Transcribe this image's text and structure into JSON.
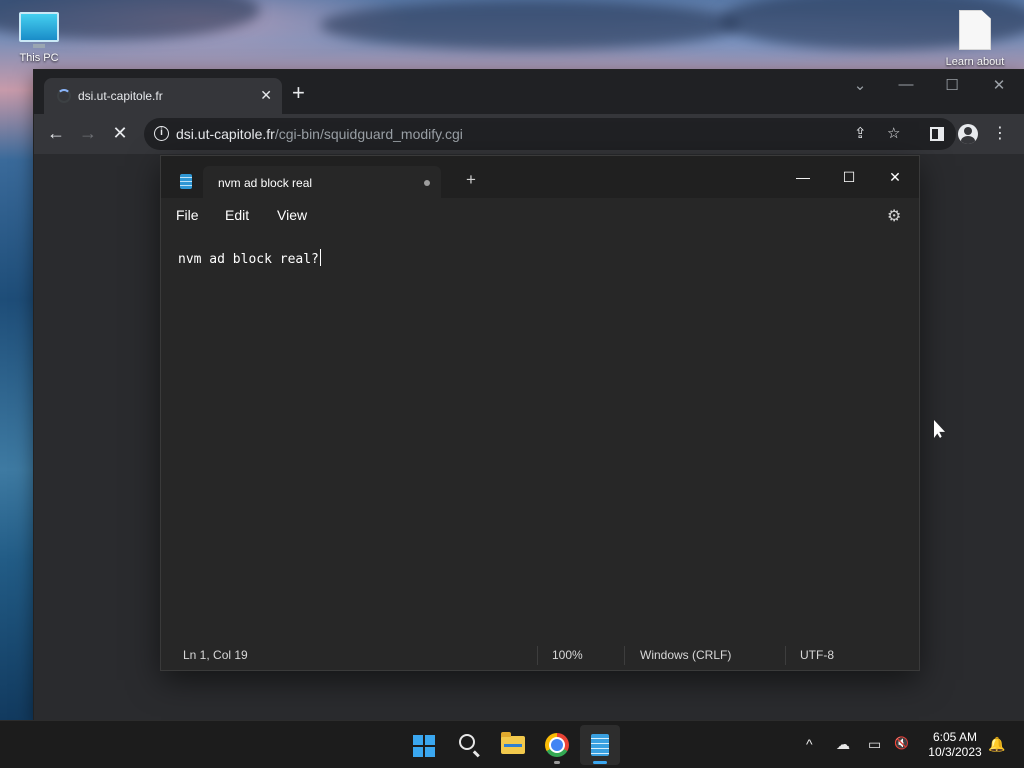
{
  "desktop": {
    "icons": [
      {
        "label": "This PC",
        "icon": "computer-monitor-icon"
      },
      {
        "label": "Learn about",
        "icon": "document-file-icon"
      }
    ]
  },
  "browser": {
    "tab": {
      "title": "dsi.ut-capitole.fr",
      "loading": true
    },
    "new_tab_symbol": "+",
    "url_host": "dsi.ut-capitole.fr",
    "url_path": "/cgi-bin/squidguard_modify.cgi",
    "icons": {
      "back": "←",
      "forward": "→",
      "stop": "✕",
      "share": "⇪",
      "bookmark": "☆",
      "menu": "⋮",
      "tab_close": "✕",
      "tab_search": "⌄",
      "minimize": "—",
      "maximize": "☐",
      "close": "✕"
    }
  },
  "notepad": {
    "tab_title": "nvm ad block real",
    "new_tab_symbol": "+",
    "window_controls": {
      "minimize": "—",
      "maximize": "☐",
      "close": "✕"
    },
    "menu": {
      "file": "File",
      "edit": "Edit",
      "view": "View"
    },
    "settings_icon": "⚙",
    "content": "nvm ad block real?",
    "status": {
      "position": "Ln 1, Col 19",
      "zoom": "100%",
      "line_ending": "Windows (CRLF)",
      "encoding": "UTF-8"
    }
  },
  "taskbar": {
    "apps": [
      "start",
      "search",
      "file-explorer",
      "chrome",
      "notepad"
    ],
    "tray": {
      "chevron": "^",
      "onedrive": "☁",
      "network": "▭",
      "volume": "🔇"
    },
    "time": "6:05 AM",
    "date": "10/3/2023",
    "notification_icon": "🔔"
  },
  "colors": {
    "accent": "#3aa7f0",
    "notepad_bg": "#272727",
    "browser_bg": "#35363a",
    "taskbar_bg": "#1c1c1c"
  }
}
